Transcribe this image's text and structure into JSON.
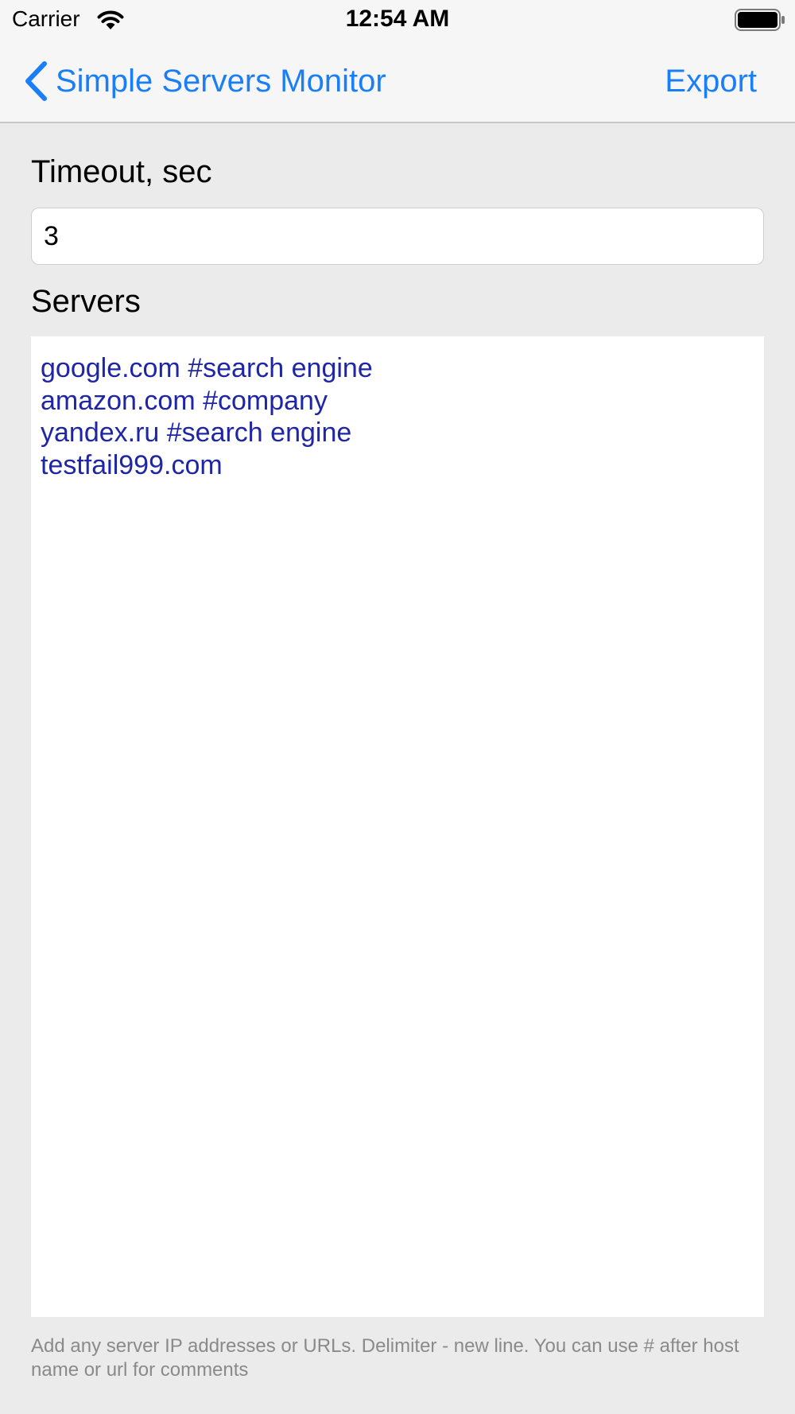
{
  "status_bar": {
    "carrier": "Carrier",
    "time": "12:54 AM",
    "wifi_icon": "wifi-icon",
    "battery_icon": "battery-icon"
  },
  "nav": {
    "back_label": "Simple Servers Monitor",
    "back_icon": "chevron-left-icon",
    "export_label": "Export",
    "accent_color": "#1a7ef6"
  },
  "form": {
    "timeout_label": "Timeout, sec",
    "timeout_value": "3",
    "servers_label": "Servers",
    "servers": [
      "google.com #search engine",
      "amazon.com #company",
      "yandex.ru #search engine",
      "testfail999.com"
    ],
    "servers_text_color": "#1f26a5",
    "hint": "Add any server IP addresses or URLs. Delimiter - new line. You can use # after host name or url for comments"
  }
}
